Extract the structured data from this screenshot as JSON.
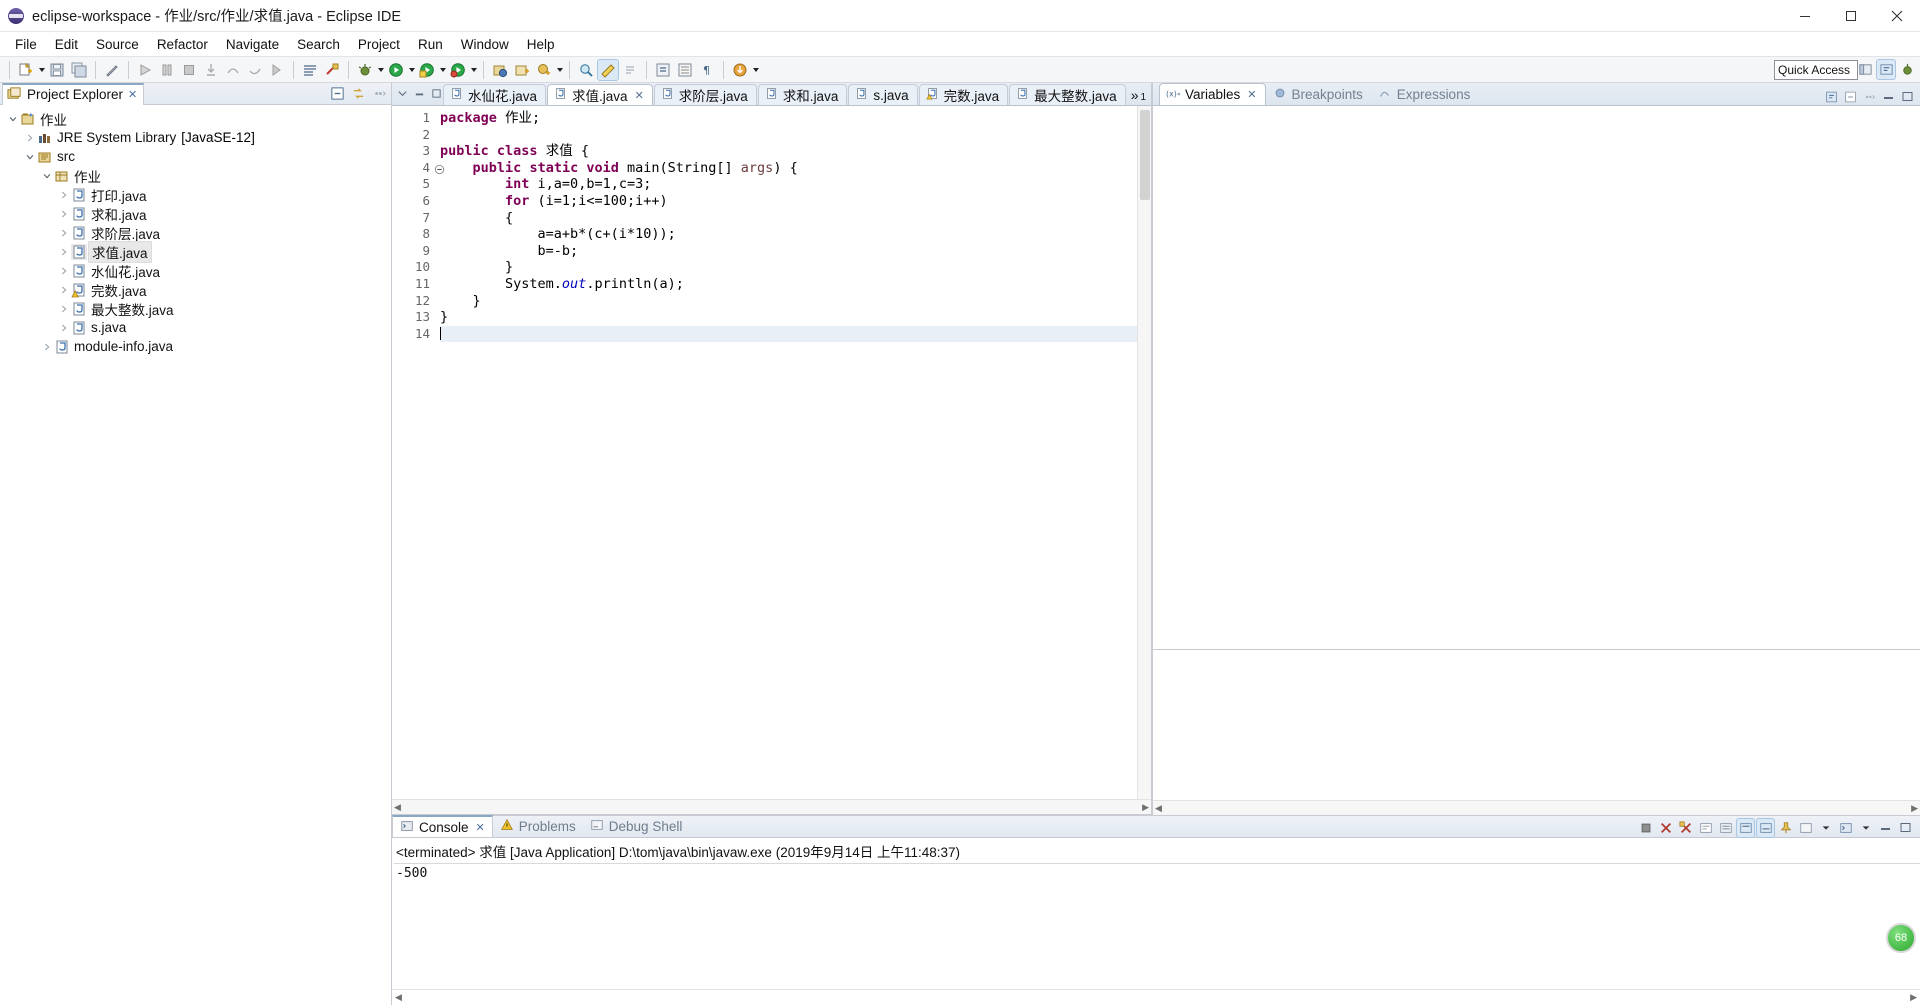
{
  "window": {
    "title": "eclipse-workspace - 作业/src/作业/求值.java - Eclipse IDE",
    "app_icon": "eclipse-icon",
    "minimize": "minimize-icon",
    "maximize": "maximize-icon",
    "close": "close-icon"
  },
  "menu": [
    {
      "label": "File"
    },
    {
      "label": "Edit"
    },
    {
      "label": "Source"
    },
    {
      "label": "Refactor"
    },
    {
      "label": "Navigate"
    },
    {
      "label": "Search"
    },
    {
      "label": "Project"
    },
    {
      "label": "Run"
    },
    {
      "label": "Window"
    },
    {
      "label": "Help"
    }
  ],
  "toolbar": {
    "quick_access_placeholder": "Quick Access",
    "quick_access_value": "Quick Access"
  },
  "project_explorer": {
    "title": "Project Explorer",
    "close_glyph": "✕",
    "tree": [
      {
        "label": "作业",
        "depth": 0,
        "expanded": true,
        "icon": "java-project-icon",
        "selected": false,
        "suffix": ""
      },
      {
        "label": "JRE System Library",
        "depth": 1,
        "expanded": false,
        "icon": "library-icon",
        "selected": false,
        "suffix": "[JavaSE-12]"
      },
      {
        "label": "src",
        "depth": 1,
        "expanded": true,
        "icon": "source-folder-icon",
        "selected": false,
        "suffix": ""
      },
      {
        "label": "作业",
        "depth": 2,
        "expanded": true,
        "icon": "package-icon",
        "selected": false,
        "suffix": ""
      },
      {
        "label": "打印.java",
        "depth": 3,
        "expanded": false,
        "icon": "java-file-icon",
        "selected": false,
        "suffix": ""
      },
      {
        "label": "求和.java",
        "depth": 3,
        "expanded": false,
        "icon": "java-file-icon",
        "selected": false,
        "suffix": ""
      },
      {
        "label": "求阶层.java",
        "depth": 3,
        "expanded": false,
        "icon": "java-file-icon",
        "selected": false,
        "suffix": ""
      },
      {
        "label": "求值.java",
        "depth": 3,
        "expanded": false,
        "icon": "java-file-icon",
        "selected": true,
        "suffix": ""
      },
      {
        "label": "水仙花.java",
        "depth": 3,
        "expanded": false,
        "icon": "java-file-icon",
        "selected": false,
        "suffix": ""
      },
      {
        "label": "完数.java",
        "depth": 3,
        "expanded": false,
        "icon": "java-file-warning-icon",
        "selected": false,
        "suffix": ""
      },
      {
        "label": "最大整数.java",
        "depth": 3,
        "expanded": false,
        "icon": "java-file-icon",
        "selected": false,
        "suffix": ""
      },
      {
        "label": "s.java",
        "depth": 3,
        "expanded": false,
        "icon": "java-file-icon",
        "selected": false,
        "suffix": ""
      },
      {
        "label": "module-info.java",
        "depth": 2,
        "expanded": false,
        "icon": "java-file-icon",
        "selected": false,
        "suffix": ""
      }
    ]
  },
  "editor": {
    "tabs": [
      {
        "label": "水仙花.java",
        "active": false,
        "dirty": false,
        "icon": "java-file-icon"
      },
      {
        "label": "求值.java",
        "active": true,
        "dirty": false,
        "icon": "java-file-icon",
        "close_glyph": "✕"
      },
      {
        "label": "求阶层.java",
        "active": false,
        "dirty": false,
        "icon": "java-file-icon"
      },
      {
        "label": "求和.java",
        "active": false,
        "dirty": false,
        "icon": "java-file-icon"
      },
      {
        "label": "s.java",
        "active": false,
        "dirty": false,
        "icon": "java-file-icon"
      },
      {
        "label": "完数.java",
        "active": false,
        "dirty": false,
        "icon": "java-file-warning-icon"
      },
      {
        "label": "最大整数.java",
        "active": false,
        "dirty": false,
        "icon": "java-file-icon"
      }
    ],
    "overflow_glyph": "»",
    "overflow_count": "1",
    "minimize": "minimize-icon",
    "maximize": "maximize-icon",
    "line_numbers": [
      "1",
      "2",
      "3",
      "4",
      "5",
      "6",
      "7",
      "8",
      "9",
      "10",
      "11",
      "12",
      "13",
      "14"
    ],
    "code_lines": [
      {
        "n": 1,
        "text": "package 作业;",
        "current": false
      },
      {
        "n": 2,
        "text": "",
        "current": false
      },
      {
        "n": 3,
        "text": "public class 求值 {",
        "current": false
      },
      {
        "n": 4,
        "text": "    public static void main(String[] args) {",
        "current": false
      },
      {
        "n": 5,
        "text": "        int i,a=0,b=1,c=3;",
        "current": false
      },
      {
        "n": 6,
        "text": "        for (i=1;i<=100;i++)",
        "current": false
      },
      {
        "n": 7,
        "text": "        {",
        "current": false
      },
      {
        "n": 8,
        "text": "            a=a+b*(c+(i*10));",
        "current": false
      },
      {
        "n": 9,
        "text": "            b=-b;",
        "current": false
      },
      {
        "n": 10,
        "text": "        }",
        "current": false
      },
      {
        "n": 11,
        "text": "        System.out.println(a);",
        "current": false
      },
      {
        "n": 12,
        "text": "    }",
        "current": false
      },
      {
        "n": 13,
        "text": "}",
        "current": false
      },
      {
        "n": 14,
        "text": "",
        "current": true
      }
    ]
  },
  "debug_views": {
    "tabs": [
      {
        "label": "Variables",
        "active": true,
        "icon": "variables-icon",
        "close_glyph": "✕"
      },
      {
        "label": "Breakpoints",
        "active": false,
        "icon": "breakpoint-icon"
      },
      {
        "label": "Expressions",
        "active": false,
        "icon": "expressions-icon"
      }
    ]
  },
  "console": {
    "tabs": [
      {
        "label": "Console",
        "active": true,
        "icon": "console-icon",
        "close_glyph": "✕"
      },
      {
        "label": "Problems",
        "active": false,
        "icon": "problems-icon"
      },
      {
        "label": "Debug Shell",
        "active": false,
        "icon": "debug-shell-icon"
      }
    ],
    "terminated_line": "<terminated> 求值 [Java Application] D:\\tom\\java\\bin\\javaw.exe (2019年9月14日 上午11:48:37)",
    "output": "-500"
  },
  "badge": {
    "value": "68"
  },
  "colors": {
    "keyword": "#7f0055",
    "field": "#0000c0",
    "param": "#6a3e3e",
    "selection": "#e8eff7",
    "accent": "#8ba7c4"
  }
}
